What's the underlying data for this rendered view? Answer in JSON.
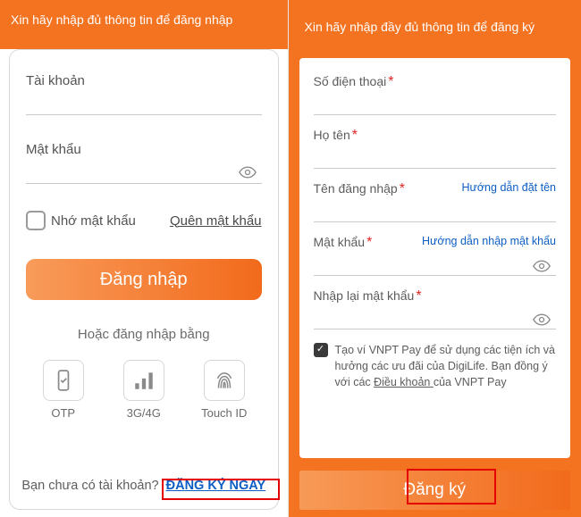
{
  "login": {
    "heading": "Xin hãy nhập đủ thông tin để đăng nhập",
    "username_label": "Tài khoản",
    "password_label": "Mật khẩu",
    "remember_label": "Nhớ mật khẩu",
    "forgot_label": "Quên mật khẩu",
    "submit_label": "Đăng nhập",
    "alt_heading": "Hoặc đăng nhập bằng",
    "alt": {
      "otp": "OTP",
      "sim": "3G/4G",
      "touch": "Touch ID"
    },
    "footer_plain": "Bạn chưa có tài khoản?",
    "footer_link": "ĐĂNG KÝ NGAY"
  },
  "signup": {
    "heading": "Xin hãy nhập đầy đủ thông tin để đăng ký",
    "phone_label": "Số điện thoại",
    "fullname_label": "Họ tên",
    "username_label": "Tên đăng nhập",
    "username_hint": "Hướng dẫn đặt tên",
    "password_label": "Mật khẩu",
    "password_hint": "Hướng dẫn nhập mật khẩu",
    "confirm_label": "Nhập lại mật khẩu",
    "consent_a": "Tạo ví VNPT Pay để sử dụng các tiện ích và hưởng các ưu đãi của DigiLife. Bạn đồng ý với các ",
    "consent_link": "Điều khoản ",
    "consent_b": "của VNPT Pay",
    "submit_label": "Đăng ký"
  }
}
